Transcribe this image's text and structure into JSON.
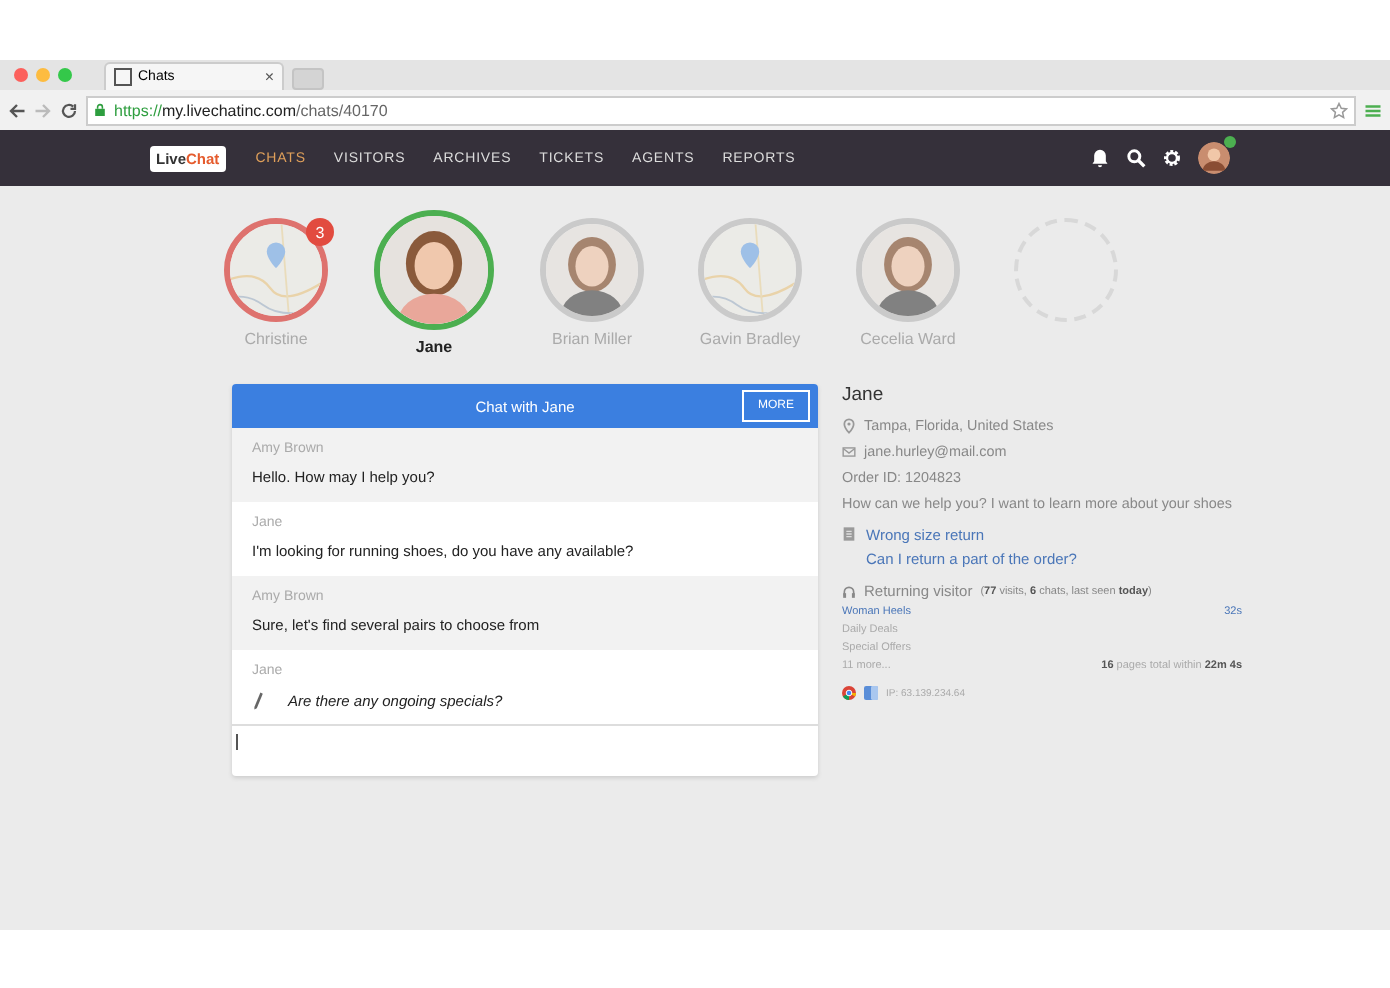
{
  "browser": {
    "tab_title": "Chats",
    "tab_close": "×",
    "url": {
      "scheme": "https://",
      "host": "my.livechatinc.com",
      "path": "/chats/40170"
    }
  },
  "nav": {
    "logo": [
      "Live",
      "Chat"
    ],
    "items": [
      {
        "label": "CHATS",
        "selected": true
      },
      {
        "label": "VISITORS",
        "selected": false
      },
      {
        "label": "ARCHIVES",
        "selected": false
      },
      {
        "label": "TICKETS",
        "selected": false
      },
      {
        "label": "AGENTS",
        "selected": false
      },
      {
        "label": "REPORTS",
        "selected": false
      }
    ],
    "online": true
  },
  "visitors": [
    {
      "kind": "map",
      "name": "Christine",
      "color": "#d9403a",
      "badge": "3",
      "selected": false
    },
    {
      "kind": "person",
      "name": "Jane",
      "color": "#4caf50",
      "selected": true
    },
    {
      "kind": "person",
      "name": "Brian Miller",
      "color": "#bdbdbd",
      "selected": false
    },
    {
      "kind": "map",
      "name": "Gavin Bradley",
      "color": "#bdbdbd",
      "selected": false
    },
    {
      "kind": "person",
      "name": "Cecelia Ward",
      "color": "#bdbdbd",
      "selected": false
    },
    {
      "kind": "empty"
    }
  ],
  "chat": {
    "title": "Chat with Jane",
    "more": "MORE",
    "messages": [
      {
        "kind": "agent",
        "author": "Amy Brown",
        "text": "Hello. How may I help you?"
      },
      {
        "kind": "visitor",
        "author": "Jane",
        "text": "I'm looking for running shoes, do you have any available?"
      },
      {
        "kind": "agent",
        "author": "Amy Brown",
        "text": "Sure, let's find several pairs to choose from"
      },
      {
        "kind": "typing",
        "author": "Jane",
        "text": "Are there any ongoing specials?"
      }
    ]
  },
  "details": {
    "name": "Jane",
    "location": "Tampa, Florida, United States",
    "email": "jane.hurley@mail.com",
    "order": "Order ID: 1204823",
    "question": "How can we help you? I want to learn more about your shoes",
    "tickets": [
      "Wrong size return",
      "Can I return a part of the order?"
    ],
    "returning": "Returning visitor",
    "visits": "(**77** visits, **6** chats, last seen **today**)",
    "pages": [
      {
        "title": "Woman Heels",
        "current": true,
        "time": "32s"
      },
      {
        "title": "Daily Deals",
        "current": false
      },
      {
        "title": "Special Offers",
        "current": false
      }
    ],
    "more": "11 more...",
    "total": "**16** pages total within **22m 4s**",
    "ip": "IP: 63.139.234.64"
  }
}
